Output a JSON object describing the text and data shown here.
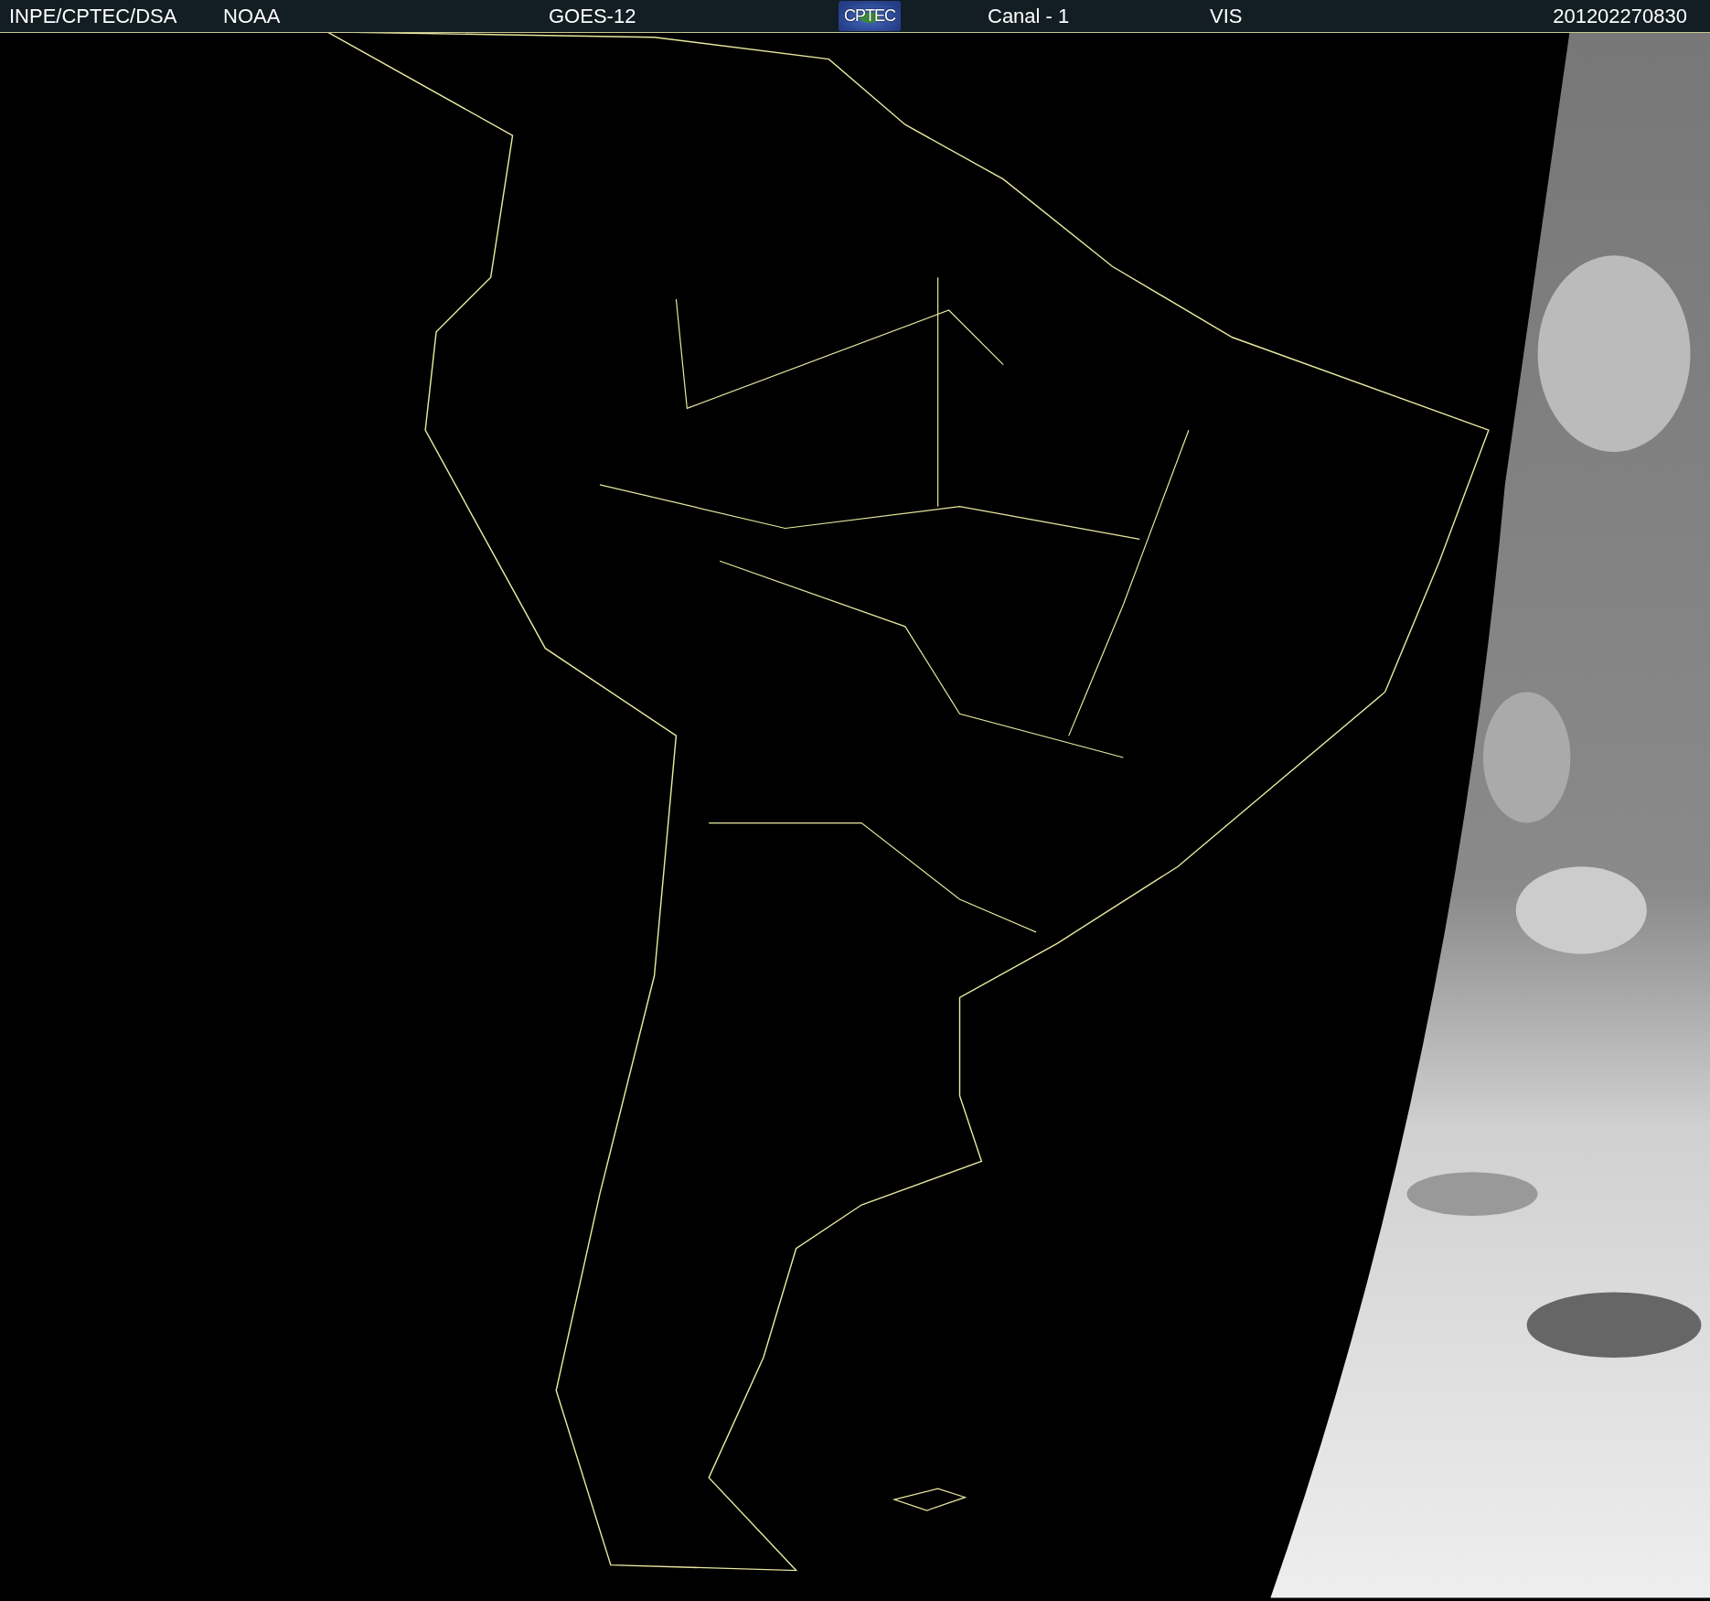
{
  "header": {
    "source": "INPE/CPTEC/DSA",
    "agency": "NOAA",
    "satellite": "GOES-12",
    "logo": "CPTEC",
    "channel": "Canal - 1",
    "band": "VIS",
    "timestamp": "201202270830"
  }
}
